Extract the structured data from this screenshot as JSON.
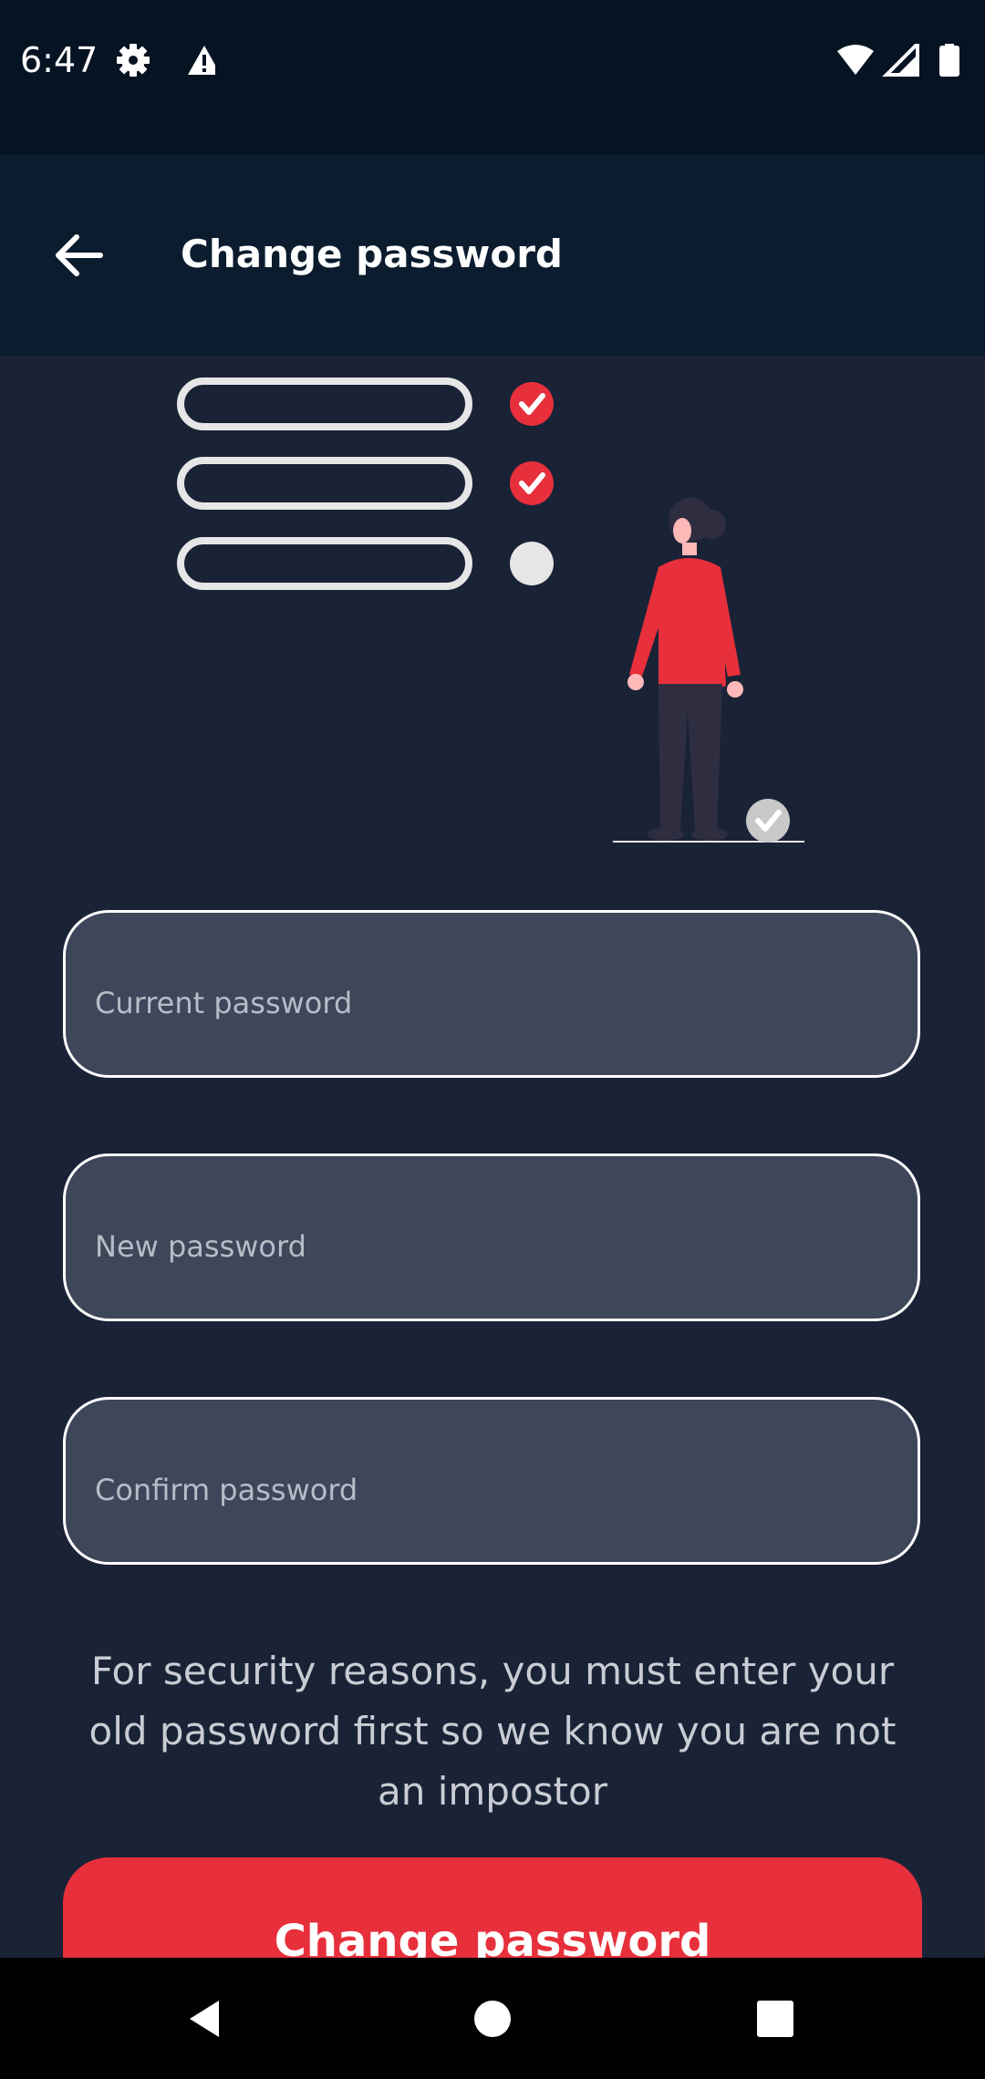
{
  "status_bar": {
    "time": "6:47",
    "left_icons": [
      "gear-icon",
      "warning-icon"
    ],
    "right_icons": [
      "wifi-icon",
      "signal-icon",
      "battery-icon"
    ]
  },
  "app_bar": {
    "title": "Change password",
    "back_icon": "arrow-left-icon"
  },
  "illustration": {
    "checklist": [
      {
        "checked": true
      },
      {
        "checked": true
      },
      {
        "checked": false
      }
    ]
  },
  "form": {
    "current_password": {
      "placeholder": "Current password",
      "value": ""
    },
    "new_password": {
      "placeholder": "New password",
      "value": ""
    },
    "confirm_password": {
      "placeholder": "Confirm password",
      "value": ""
    }
  },
  "helper_text": "For security reasons, you must enter your old password first so we know you are not an impostor",
  "submit_label": "Change password",
  "nav_bar": {
    "items": [
      "back-triangle-icon",
      "home-circle-icon",
      "recents-square-icon"
    ]
  },
  "colors": {
    "background": "#1a2236",
    "app_bar": "#0b1c2e",
    "accent": "#e7303c",
    "field_fill": "#3e4659"
  }
}
